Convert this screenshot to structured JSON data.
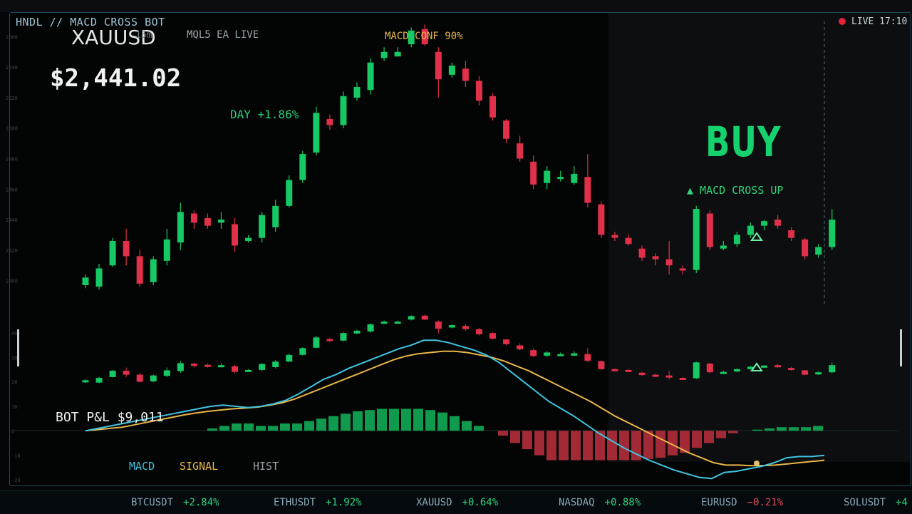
{
  "header": {
    "bot_title": "HNDL // MACD CROSS BOT",
    "symbol": "XAUUSD",
    "timeframe": "15m",
    "mode": "MQL5 EA LIVE",
    "price": "$2,441.02",
    "day_change": "DAY  +1.86%",
    "confidence": "MACD CONF 90%",
    "live_status": "LIVE 17:10"
  },
  "signal": {
    "action": "BUY",
    "reason": "▲ MACD CROSS UP"
  },
  "bot_pnl": "BOT P&L  $9,011",
  "legend": {
    "macd": "MACD",
    "signal": "SIGNAL",
    "hist": "HIST"
  },
  "ticker": [
    {
      "symbol": "BTCUSDT",
      "change": "+2.84%",
      "dir": "up"
    },
    {
      "symbol": "ETHUSDT",
      "change": "+1.92%",
      "dir": "up"
    },
    {
      "symbol": "XAUUSD",
      "change": "+0.64%",
      "dir": "up"
    },
    {
      "symbol": "NASDAQ",
      "change": "+0.88%",
      "dir": "up"
    },
    {
      "symbol": "EURUSD",
      "change": "−0.21%",
      "dir": "down"
    },
    {
      "symbol": "SOLUSDT",
      "change": "+4",
      "dir": "up"
    }
  ],
  "colors": {
    "bull": "#17c964",
    "bear": "#e0304a",
    "macd": "#3fc4df",
    "signal": "#e8b64a",
    "hist_pos": "#0f9a4e",
    "hist_neg": "#a22a36"
  },
  "chart_data": [
    {
      "type": "candlestick",
      "ylim": [
        2390,
        2570
      ],
      "ticks": [
        2400,
        2420,
        2440,
        2460,
        2480,
        2500,
        2520,
        2540,
        2560
      ],
      "candles": [
        [
          2397,
          2402,
          2395,
          2404
        ],
        [
          2396,
          2408,
          2394,
          2411
        ],
        [
          2410,
          2426,
          2409,
          2428
        ],
        [
          2426,
          2416,
          2410,
          2434
        ],
        [
          2416,
          2398,
          2396,
          2420
        ],
        [
          2399,
          2414,
          2397,
          2416
        ],
        [
          2413,
          2427,
          2410,
          2434
        ],
        [
          2425,
          2445,
          2420,
          2451
        ],
        [
          2444,
          2438,
          2434,
          2446
        ],
        [
          2441,
          2436,
          2434,
          2444
        ],
        [
          2438,
          2440,
          2434,
          2445
        ],
        [
          2437,
          2423,
          2419,
          2441
        ],
        [
          2426,
          2428,
          2425,
          2430
        ],
        [
          2428,
          2443,
          2425,
          2445
        ],
        [
          2435,
          2449,
          2432,
          2453
        ],
        [
          2449,
          2466,
          2448,
          2469
        ],
        [
          2466,
          2483,
          2464,
          2485
        ],
        [
          2484,
          2510,
          2482,
          2514
        ],
        [
          2506,
          2502,
          2499,
          2509
        ],
        [
          2502,
          2521,
          2500,
          2524
        ],
        [
          2520,
          2527,
          2518,
          2530
        ],
        [
          2525,
          2543,
          2522,
          2546
        ],
        [
          2546,
          2550,
          2544,
          2553
        ],
        [
          2547,
          2550,
          2547,
          2553
        ],
        [
          2555,
          2564,
          2553,
          2566
        ],
        [
          2565,
          2555,
          2554,
          2568
        ],
        [
          2550,
          2532,
          2520,
          2553
        ],
        [
          2535,
          2541,
          2533,
          2543
        ],
        [
          2539,
          2531,
          2527,
          2544
        ],
        [
          2531,
          2518,
          2515,
          2534
        ],
        [
          2521,
          2507,
          2505,
          2523
        ],
        [
          2505,
          2493,
          2490,
          2506
        ],
        [
          2490,
          2480,
          2478,
          2495
        ],
        [
          2478,
          2463,
          2460,
          2482
        ],
        [
          2464,
          2472,
          2460,
          2475
        ],
        [
          2468,
          2468,
          2465,
          2472
        ],
        [
          2464,
          2470,
          2463,
          2475
        ],
        [
          2468,
          2451,
          2448,
          2483
        ],
        [
          2450,
          2430,
          2428,
          2452
        ],
        [
          2430,
          2428,
          2426,
          2432
        ],
        [
          2428,
          2424,
          2423,
          2430
        ],
        [
          2421,
          2415,
          2413,
          2423
        ],
        [
          2416,
          2414,
          2410,
          2418
        ],
        [
          2414,
          2410,
          2404,
          2426
        ],
        [
          2408,
          2407,
          2404,
          2410
        ],
        [
          2407,
          2447,
          2405,
          2449
        ],
        [
          2444,
          2422,
          2420,
          2446
        ],
        [
          2421,
          2423,
          2420,
          2426
        ],
        [
          2424,
          2430,
          2422,
          2432
        ],
        [
          2430,
          2436,
          2428,
          2438
        ],
        [
          2436,
          2439,
          2433,
          2440
        ],
        [
          2440,
          2436,
          2434,
          2443
        ],
        [
          2433,
          2428,
          2426,
          2435
        ],
        [
          2427,
          2416,
          2414,
          2428
        ],
        [
          2417,
          2422,
          2415,
          2424
        ],
        [
          2422,
          2440,
          2420,
          2447
        ]
      ]
    },
    {
      "type": "line",
      "ylim": [
        -20,
        40
      ],
      "ticks": [
        -20,
        -10,
        0,
        10,
        20,
        30,
        40
      ],
      "series": [
        {
          "name": "MACD",
          "values": [
            0,
            1,
            2,
            3,
            4,
            5,
            6,
            7,
            8,
            9,
            10,
            10.5,
            10,
            9.5,
            10,
            11,
            12.5,
            15,
            18,
            21,
            23,
            25.5,
            27.5,
            29.5,
            31.5,
            33.5,
            35,
            37,
            37,
            36,
            34.5,
            33,
            31,
            28,
            24,
            20,
            16,
            12,
            9,
            6,
            2.5,
            -1,
            -4,
            -7,
            -9.5,
            -12,
            -14,
            -16,
            -17.5,
            -19,
            -19.5,
            -17,
            -16.5,
            -15.5,
            -14.5,
            -13,
            -11,
            -10.5,
            -10.5,
            -10
          ]
        },
        {
          "name": "SIGNAL",
          "values": [
            0,
            0.5,
            1,
            1.5,
            2.5,
            3.5,
            4.5,
            5.5,
            6.5,
            7.3,
            8,
            8.5,
            9,
            9.3,
            9.7,
            10.5,
            11.5,
            13,
            15,
            17,
            19,
            21,
            23,
            25,
            27,
            29,
            30.5,
            31.5,
            32,
            32.5,
            32.5,
            32,
            31,
            30,
            28.5,
            26.5,
            24.5,
            22,
            19.5,
            17,
            14.5,
            12,
            9,
            6,
            3.5,
            1,
            -1.5,
            -4,
            -6.5,
            -9,
            -11,
            -13,
            -14,
            -14,
            -14.2,
            -14.2,
            -14,
            -13.5,
            -13,
            -12.5,
            -12
          ]
        },
        {
          "name": "HIST",
          "values": [
            0,
            0,
            0,
            0,
            0,
            0,
            0,
            0,
            0,
            0,
            1,
            2,
            3,
            3,
            2,
            2,
            3,
            3,
            4,
            5,
            6,
            7,
            8,
            8.5,
            9,
            9,
            9,
            9,
            8.5,
            7.5,
            6,
            4,
            2,
            0,
            -2,
            -5,
            -7.5,
            -10,
            -12,
            -12,
            -12,
            -12,
            -12,
            -12,
            -12,
            -12,
            -11.5,
            -11,
            -10,
            -9,
            -7,
            -5,
            -3,
            -1,
            0,
            0.5,
            1,
            1.5,
            1.5,
            1.5,
            2
          ]
        }
      ]
    }
  ]
}
